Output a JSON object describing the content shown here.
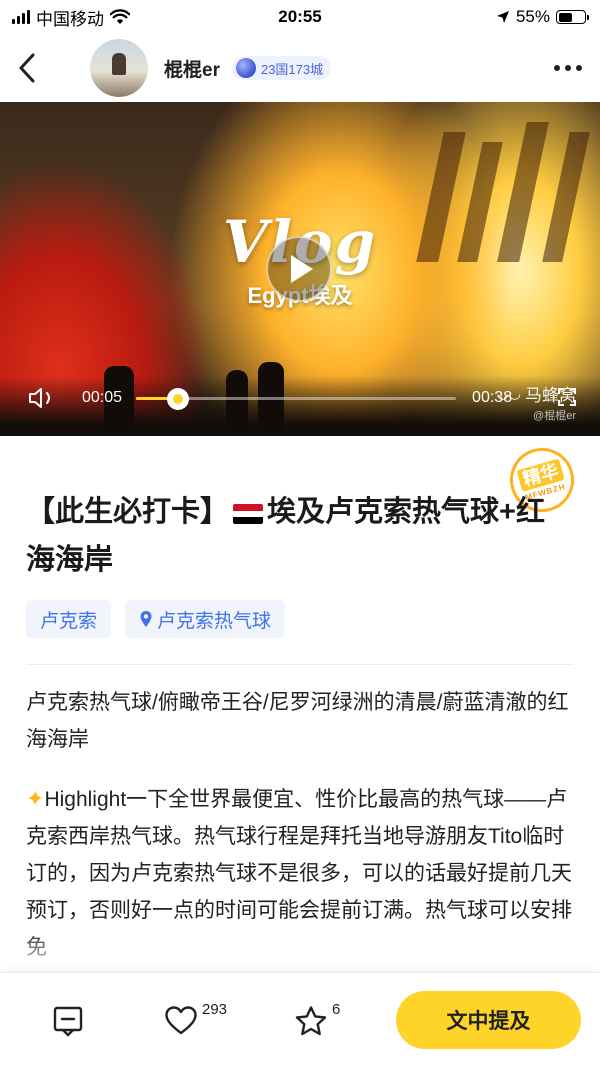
{
  "status_bar": {
    "carrier": "中国移动",
    "time": "20:55",
    "battery": "55%"
  },
  "header": {
    "user_name": "棍棍er",
    "city_badge": "23国173城"
  },
  "video": {
    "overlay_title": "Vlog",
    "overlay_subtitle": "Egypt埃及",
    "current_time": "00:05",
    "duration": "00:38",
    "progress_fraction": 0.13,
    "watermark_brand": "马蜂窝",
    "watermark_user": "@棍棍er"
  },
  "article": {
    "featured_badge": "精华",
    "featured_badge_sub": "MFWBZH",
    "title_part1": "【此生必打卡】",
    "title_part2": "埃及卢克索热气球+红海海岸",
    "tags": [
      {
        "label": "卢克索",
        "icon": ""
      },
      {
        "label": "卢克索热气球",
        "icon": "location-pin-icon"
      }
    ],
    "summary": "卢克索热气球/俯瞰帝王谷/尼罗河绿洲的清晨/蔚蓝清澈的红海海岸",
    "body": "Highlight一下全世界最便宜、性价比最高的热气球——卢克索西岸热气球。热气球行程是拜托当地导游朋友Tito临时订的，因为卢克索热气球不是很多，可以的话最好提前几天预订，否则好一点的时间可能会提前订满。热气球可以安排免"
  },
  "bottom_bar": {
    "like_count": "293",
    "favorite_count": "6",
    "mention_label": "文中提及"
  },
  "colors": {
    "accent_yellow": "#ffd428",
    "tag_blue": "#3e74e8",
    "badge_orange": "#ffb21e"
  }
}
